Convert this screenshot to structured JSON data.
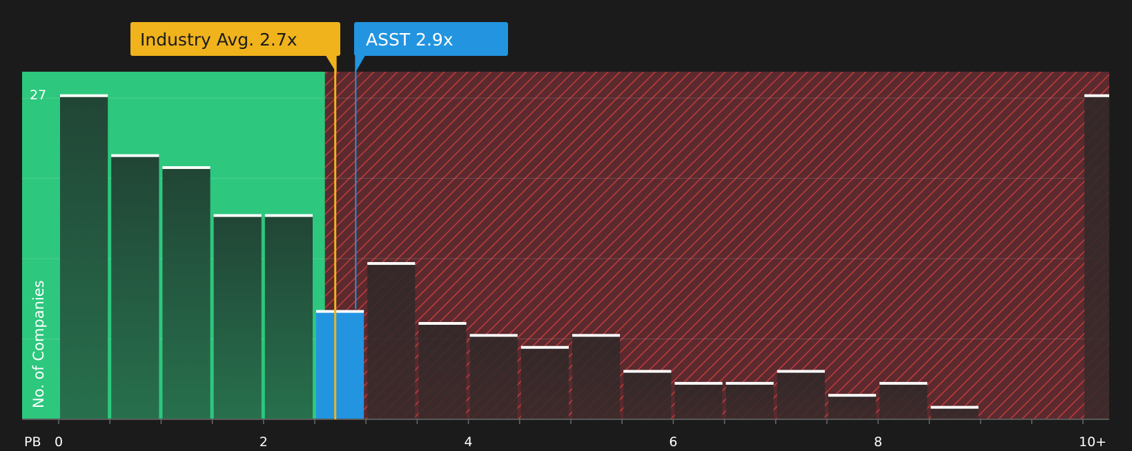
{
  "chart_data": {
    "type": "bar",
    "xlabel": "PB",
    "ylabel": "No. of Companies",
    "y_tick_label": "27",
    "ylim": [
      0,
      28
    ],
    "grid": true,
    "x_ticks": [
      {
        "value": 0,
        "label": "0"
      },
      {
        "value": 2,
        "label": "2"
      },
      {
        "value": 4,
        "label": "4"
      },
      {
        "value": 6,
        "label": "6"
      },
      {
        "value": 8,
        "label": "8"
      },
      {
        "value": 10,
        "label": "10+"
      }
    ],
    "bins": [
      {
        "start": 0.0,
        "count": 27
      },
      {
        "start": 0.5,
        "count": 22
      },
      {
        "start": 1.0,
        "count": 21
      },
      {
        "start": 1.5,
        "count": 17
      },
      {
        "start": 2.0,
        "count": 17
      },
      {
        "start": 2.5,
        "count": 9
      },
      {
        "start": 3.0,
        "count": 13
      },
      {
        "start": 3.5,
        "count": 8
      },
      {
        "start": 4.0,
        "count": 7
      },
      {
        "start": 4.5,
        "count": 6
      },
      {
        "start": 5.0,
        "count": 7
      },
      {
        "start": 5.5,
        "count": 4
      },
      {
        "start": 6.0,
        "count": 3
      },
      {
        "start": 6.5,
        "count": 3
      },
      {
        "start": 7.0,
        "count": 4
      },
      {
        "start": 7.5,
        "count": 2
      },
      {
        "start": 8.0,
        "count": 3
      },
      {
        "start": 8.5,
        "count": 1
      },
      {
        "start": 10.0,
        "count": 27
      }
    ],
    "fair_range_max": 2.6,
    "industry_avg": {
      "value": 2.7,
      "label": "Industry Avg. 2.7x"
    },
    "company": {
      "value": 2.9,
      "label": "ASST 2.9x"
    },
    "colors": {
      "background": "#1b1b1b",
      "green_zone": "#2dc77d",
      "red_zone": "#5a2a2e",
      "red_hatch": "#c63b3b",
      "bar_green": "#22483a",
      "bar_red": "#2c2828",
      "highlight": "#2394e0",
      "industry": "#f0b31c",
      "cap": "#ffffff"
    }
  }
}
